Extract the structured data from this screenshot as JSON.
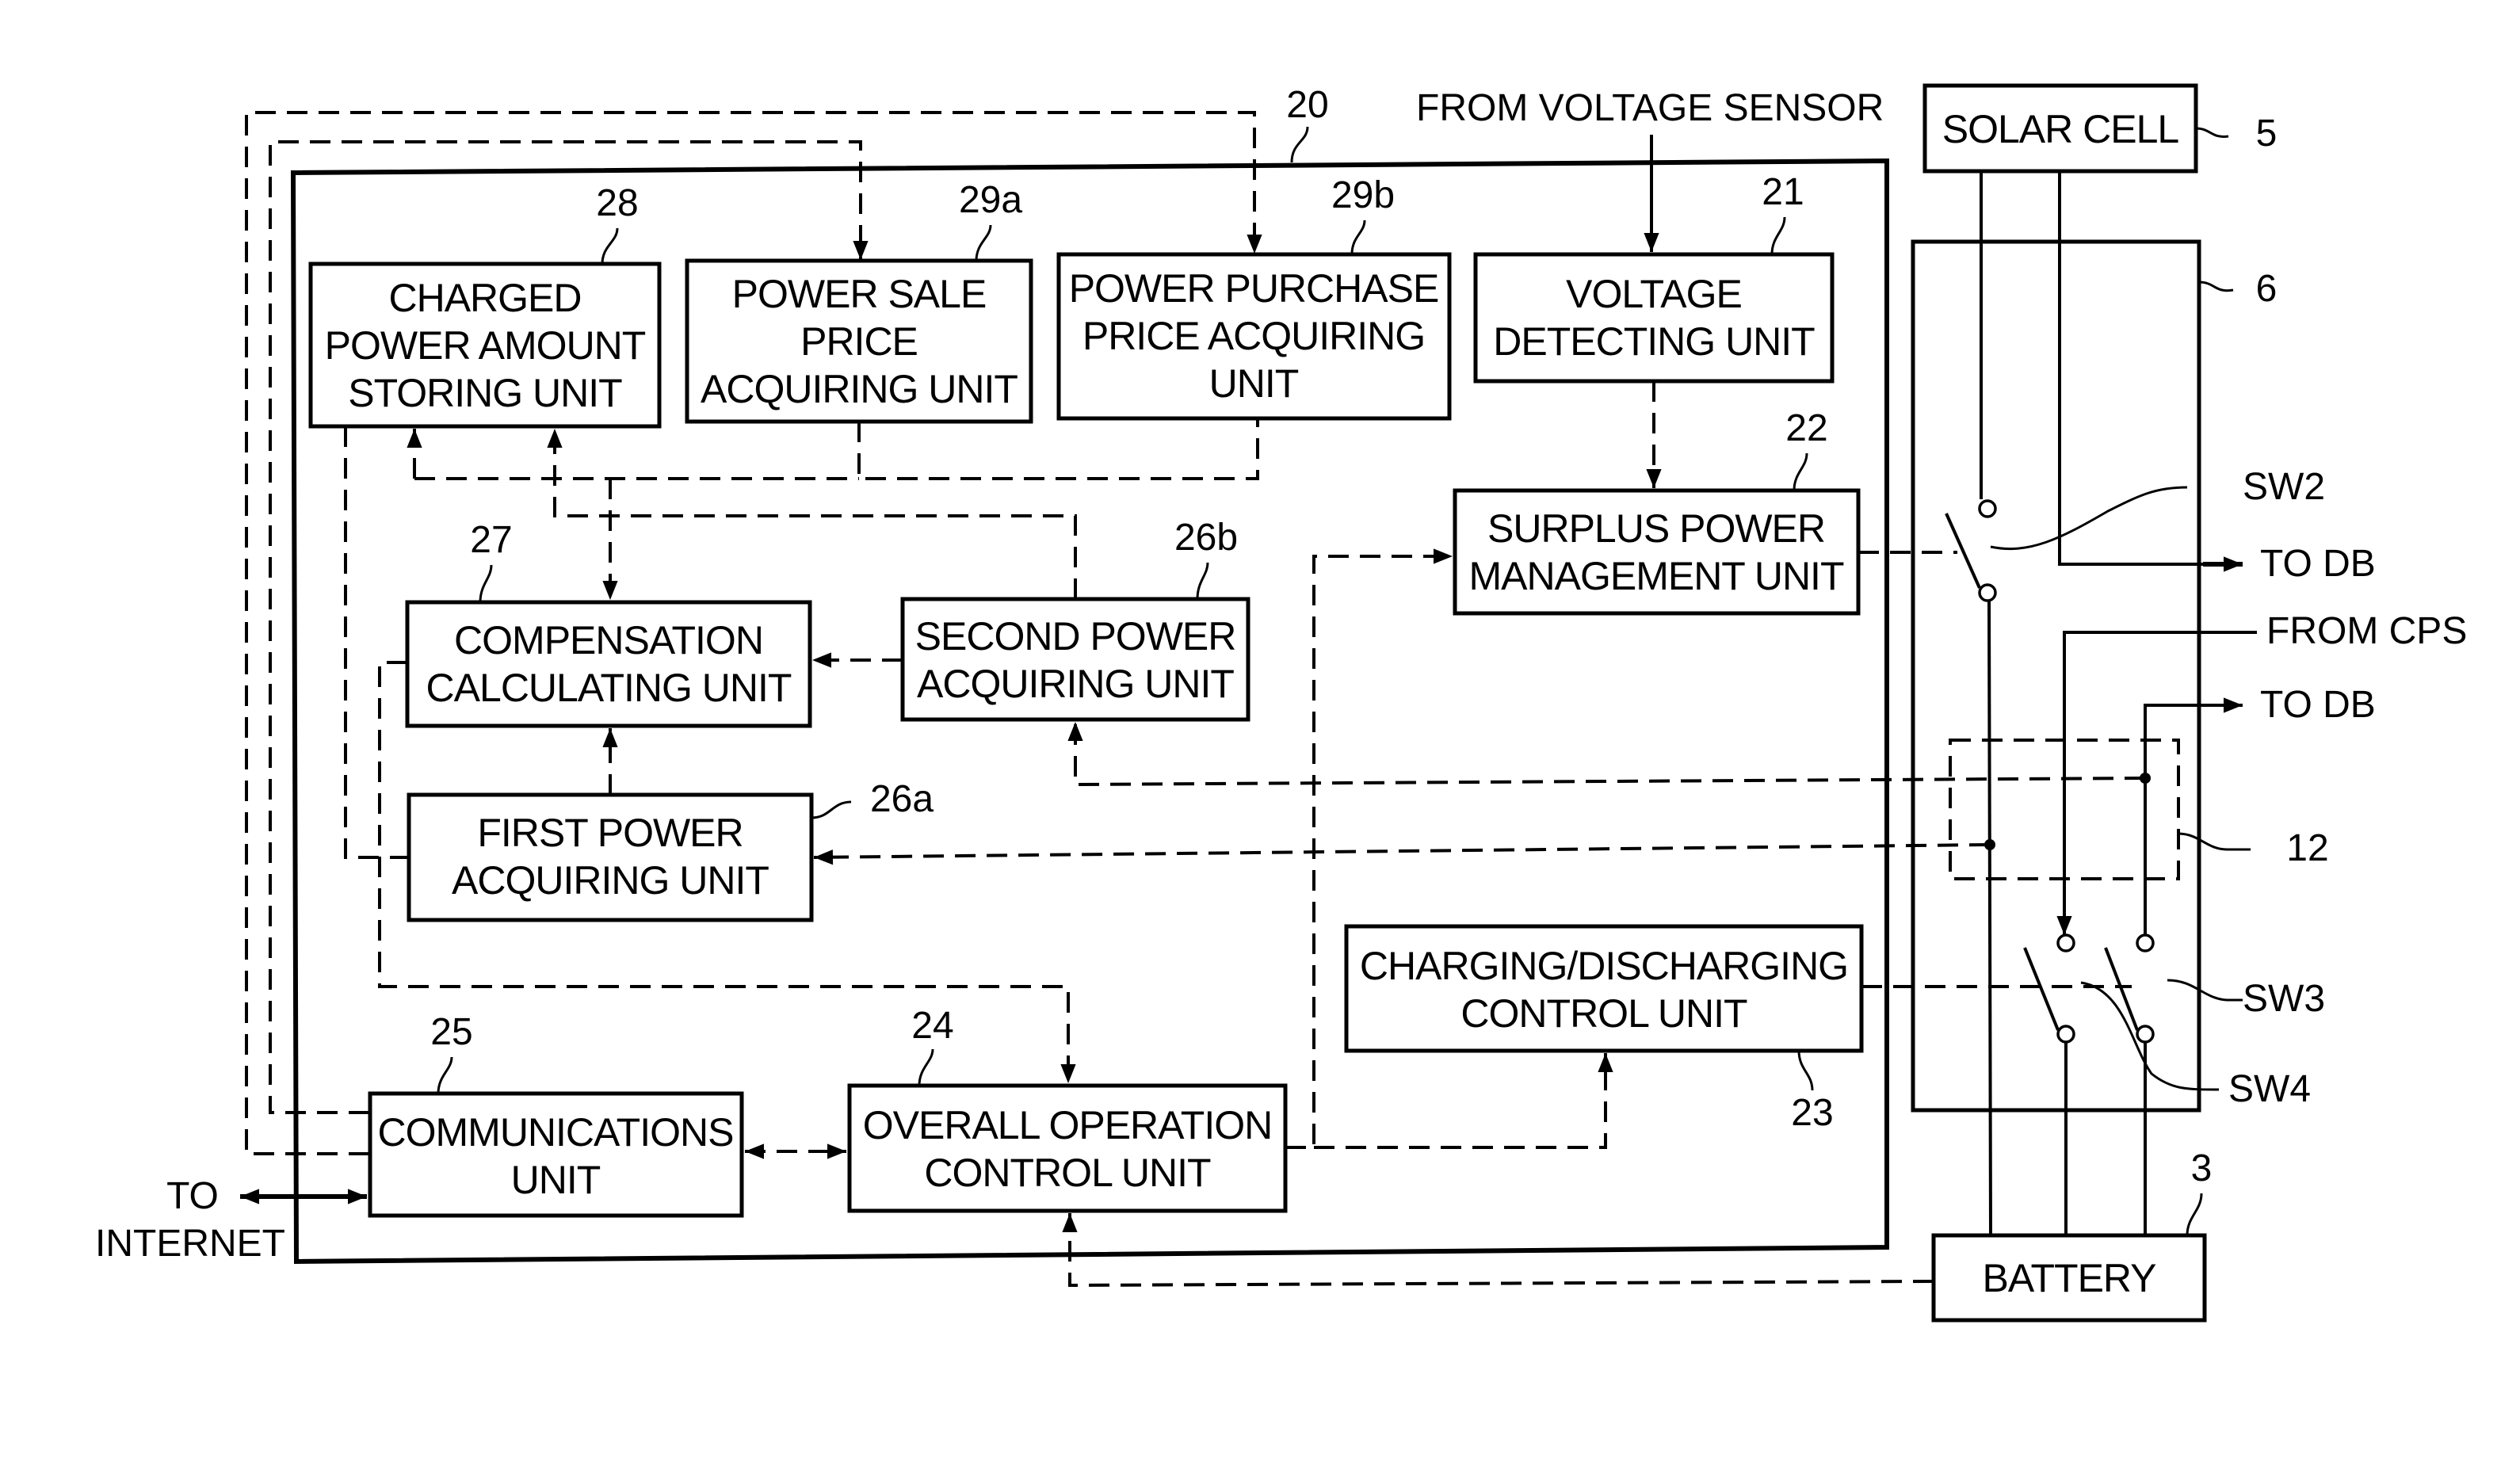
{
  "figure": {
    "blocks": {
      "charged_power": {
        "ref": "28",
        "lines": [
          "CHARGED",
          "POWER AMOUNT",
          "STORING UNIT"
        ]
      },
      "power_sale": {
        "ref": "29a",
        "lines": [
          "POWER SALE",
          "PRICE",
          "ACQUIRING UNIT"
        ]
      },
      "power_purchase": {
        "ref": "29b",
        "lines": [
          "POWER PURCHASE",
          "PRICE ACQUIRING",
          "UNIT"
        ]
      },
      "voltage_detecting": {
        "ref": "21",
        "lines": [
          "VOLTAGE",
          "DETECTING UNIT"
        ]
      },
      "surplus_power": {
        "ref": "22",
        "lines": [
          "SURPLUS POWER",
          "MANAGEMENT UNIT"
        ]
      },
      "compensation": {
        "ref": "27",
        "lines": [
          "COMPENSATION",
          "CALCULATING UNIT"
        ]
      },
      "second_power": {
        "ref": "26b",
        "lines": [
          "SECOND POWER",
          "ACQUIRING UNIT"
        ]
      },
      "first_power": {
        "ref": "26a",
        "lines": [
          "FIRST POWER",
          "ACQUIRING UNIT"
        ]
      },
      "charging_discharging": {
        "ref": "23",
        "lines": [
          "CHARGING/DISCHARGING",
          "CONTROL UNIT"
        ]
      },
      "communications": {
        "ref": "25",
        "lines": [
          "COMMUNICATIONS",
          "UNIT"
        ]
      },
      "overall_operation": {
        "ref": "24",
        "lines": [
          "OVERALL OPERATION",
          "CONTROL UNIT"
        ]
      },
      "solar_cell": {
        "ref": "5",
        "lines": [
          "SOLAR CELL"
        ]
      },
      "battery": {
        "ref": "3",
        "lines": [
          "BATTERY"
        ]
      }
    },
    "containers": {
      "controller": {
        "ref": "20"
      },
      "switch_box": {
        "ref": "6"
      },
      "sensor_block": {
        "ref": "12"
      }
    },
    "switches": {
      "sw2": "SW2",
      "sw3": "SW3",
      "sw4": "SW4"
    },
    "external_labels": {
      "from_voltage_sensor": "FROM VOLTAGE SENSOR",
      "to_db_1": "TO DB",
      "from_cps": "FROM CPS",
      "to_db_2": "TO DB",
      "to_internet_line1": "TO",
      "to_internet_line2": "INTERNET"
    }
  }
}
